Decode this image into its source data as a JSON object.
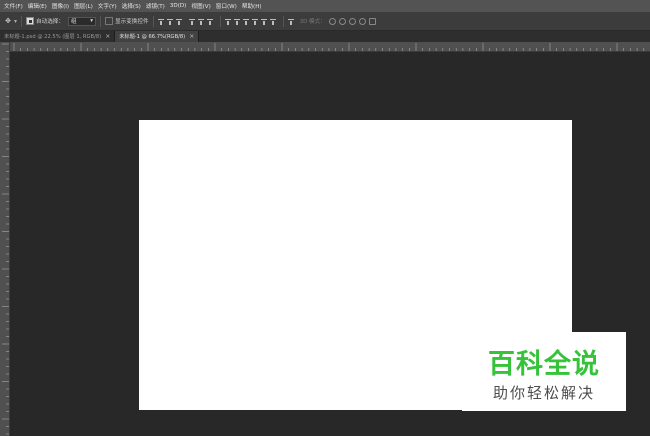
{
  "menu": {
    "items": [
      "文件(F)",
      "编辑(E)",
      "图像(I)",
      "图层(L)",
      "文字(Y)",
      "选择(S)",
      "滤镜(T)",
      "3D(D)",
      "视图(V)",
      "窗口(W)",
      "帮助(H)"
    ]
  },
  "options": {
    "tool_icon": "move-tool-icon",
    "auto_select_label": "自动选择：",
    "auto_select_value": "组",
    "show_transform_label": "显示变换控件",
    "mode_3d_label": "3D 模式："
  },
  "tabs": [
    {
      "label": "未标题-1.psd @ 22.5% (图层 1, RGB/8)",
      "active": false,
      "close": "×"
    },
    {
      "label": "未标题-1 @ 66.7%(RGB/8)",
      "active": true,
      "close": "×"
    }
  ],
  "watermark": {
    "title": "百科全说",
    "subtitle": "助你轻松解决",
    "title_color": "#36c33a"
  },
  "colors": {
    "menubar": "#535353",
    "optionsbar": "#3c3c3c",
    "workspace": "#282828",
    "canvas": "#ffffff"
  }
}
